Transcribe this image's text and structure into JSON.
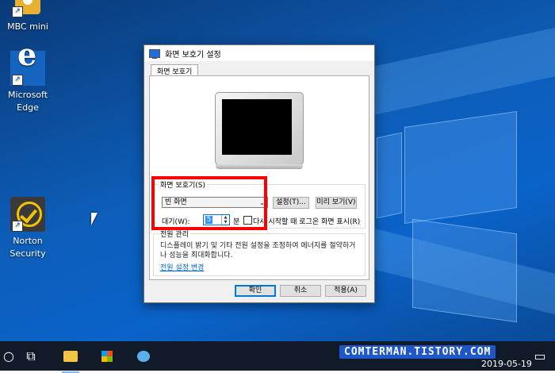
{
  "desktop": {
    "icons": [
      {
        "label": "MBC mini",
        "icon": "mbc-mini-icon"
      },
      {
        "label": "Microsoft Edge",
        "icon": "edge-icon"
      },
      {
        "label": "Norton Security",
        "icon": "norton-icon"
      }
    ]
  },
  "dialog": {
    "title": "화면 보호기 설정",
    "tab": "화면 보호기",
    "screensaver_group_label": "화면 보호기(S)",
    "screensaver_selected": "빈 화면",
    "settings_button": "설정(T)...",
    "preview_button": "미리 보기(V)",
    "wait_label": "대기(W):",
    "wait_value": "5",
    "wait_unit": "분",
    "resume_checkbox_label": "다시 시작할 때 로그온 화면 표시(R)",
    "resume_checked": false,
    "power_group_label": "전원 관리",
    "power_description": "디스플레이 밝기 및 기타 전원 설정을 조정하여 에너지를 절약하거나 성능을 최대화합니다.",
    "power_link": "전원 설정 변경",
    "ok_button": "확인",
    "cancel_button": "취소",
    "apply_button": "적용(A)"
  },
  "taskbar": {
    "watermark": "COMTERMAN.TISTORY.COM",
    "date": "2019-05-19"
  },
  "colors": {
    "highlight": "#ff0000",
    "accent": "#0078d7",
    "watermark_bg": "#1f57c9"
  }
}
